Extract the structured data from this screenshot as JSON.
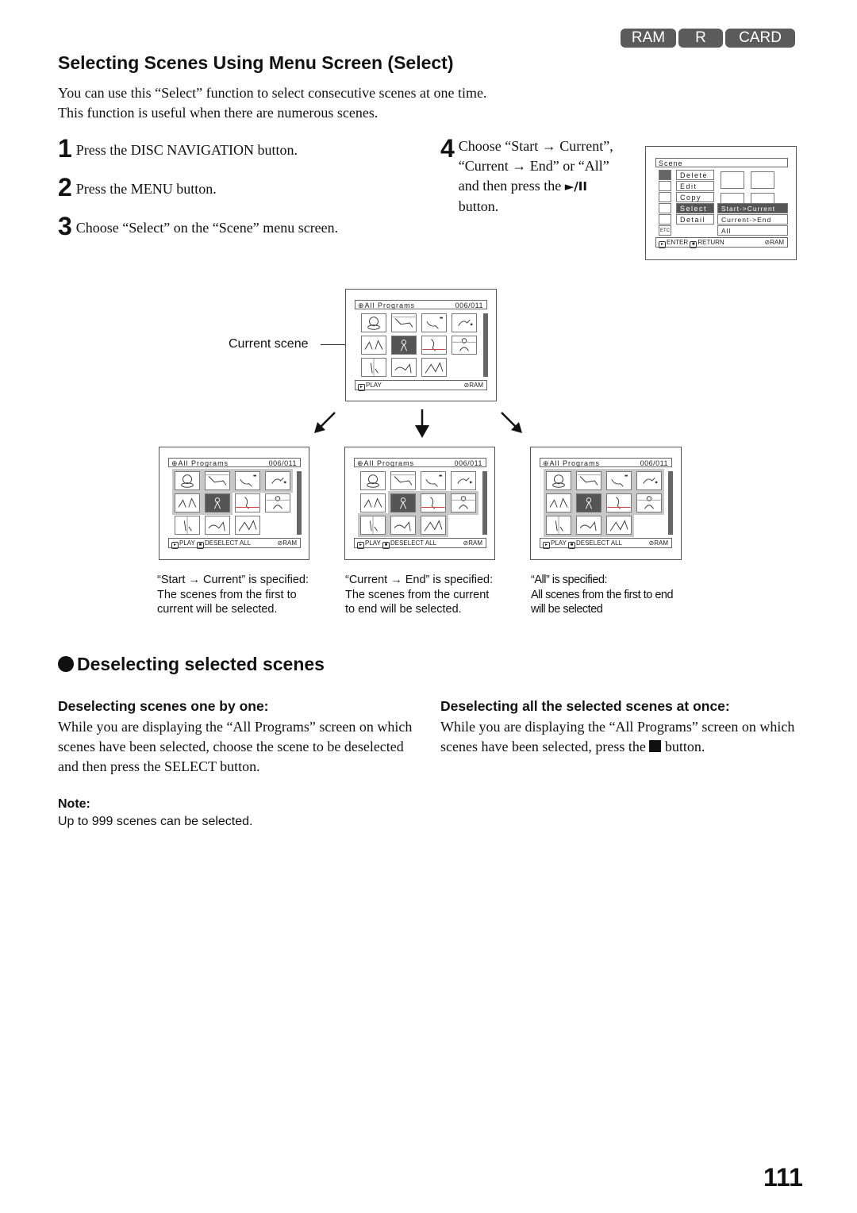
{
  "badges": [
    "RAM",
    "R",
    "CARD"
  ],
  "title": "Selecting Scenes Using Menu Screen (Select)",
  "intro": [
    "You can use this “Select” function to select consecutive scenes at one time.",
    "This function is useful when there are numerous scenes."
  ],
  "steps": [
    {
      "num": "1",
      "text": "Press the DISC NAVIGATION button."
    },
    {
      "num": "2",
      "text": "Press the MENU button."
    },
    {
      "num": "3",
      "text": "Choose “Select” on the “Scene” menu screen."
    },
    {
      "num": "4",
      "lines": [
        "Choose “Start → Current”,",
        "“Current → End” or “All”",
        "and then press the",
        "button."
      ],
      "button_icon": "play-pause-icon",
      "button_glyph": "►/II"
    }
  ],
  "scene_menu": {
    "title": "Scene",
    "items": [
      "Delete",
      "Edit",
      "Copy",
      "Select",
      "Detail"
    ],
    "active_item": "Select",
    "submenu": [
      "Start->Current",
      "Current->End",
      "All"
    ],
    "active_submenu": "Start->Current",
    "icon_etc": "ETC",
    "footer": {
      "enter": "ENTER",
      "return": "RETURN",
      "media": "RAM"
    }
  },
  "current_scene_label": "Current scene",
  "screens": {
    "title": "All Programs",
    "count": "006/011",
    "play": "PLAY",
    "deselect_all": "DESELECT ALL",
    "media": "RAM"
  },
  "captions": [
    [
      "“Start → Current” is specified:",
      "The scenes from the first to",
      "current will be selected."
    ],
    [
      "“Current → End” is specified:",
      "The scenes from the current",
      "to end will be selected."
    ],
    [
      "“All” is specified:",
      "All scenes from the first to end",
      "will be selected"
    ]
  ],
  "deselect": {
    "heading": "Deselecting selected scenes",
    "one_by_one": {
      "heading": "Deselecting scenes one by one:",
      "text": "While you are displaying the “All Programs” screen on which scenes have been selected, choose the scene to be deselected and then press the SELECT button."
    },
    "all_at_once": {
      "heading": "Deselecting all the selected scenes at once:",
      "text_before": "While you are displaying the “All Programs” screen on which scenes have been selected, press the",
      "text_after": "button.",
      "button_icon": "stop-icon"
    }
  },
  "note": {
    "heading": "Note:",
    "text": "Up to 999 scenes can be selected."
  },
  "page_number": "111"
}
